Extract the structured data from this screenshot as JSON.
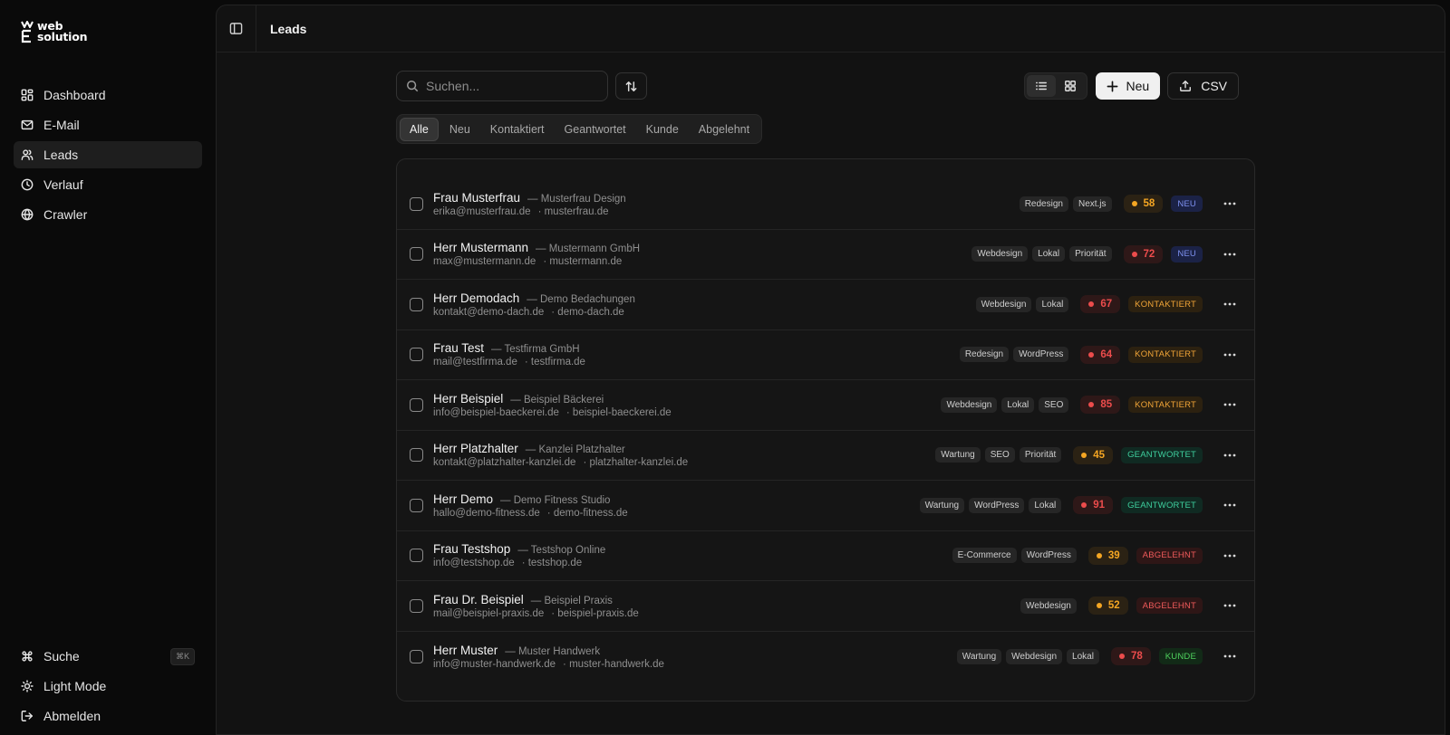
{
  "brand": {
    "line1": "web",
    "line2": "solution"
  },
  "sidebar": {
    "items": [
      {
        "label": "Dashboard",
        "icon": "dashboard-icon"
      },
      {
        "label": "E-Mail",
        "icon": "mail-icon"
      },
      {
        "label": "Leads",
        "icon": "users-icon",
        "active": true
      },
      {
        "label": "Verlauf",
        "icon": "clock-icon"
      },
      {
        "label": "Crawler",
        "icon": "globe-icon"
      }
    ],
    "bottom": [
      {
        "label": "Suche",
        "icon": "command-icon",
        "shortcut": "⌘K"
      },
      {
        "label": "Light Mode",
        "icon": "sun-icon"
      },
      {
        "label": "Abmelden",
        "icon": "logout-icon"
      }
    ]
  },
  "header": {
    "title": "Leads"
  },
  "toolbar": {
    "search_placeholder": "Suchen...",
    "new_label": "Neu",
    "csv_label": "CSV"
  },
  "tabs": [
    "Alle",
    "Neu",
    "Kontaktiert",
    "Geantwortet",
    "Kunde",
    "Abgelehnt"
  ],
  "leads": [
    {
      "name": "Frau Musterfrau",
      "company": "— Musterfrau Design",
      "email": "erika@musterfrau.de",
      "website": "· musterfrau.de",
      "tags": [
        "Redesign",
        "Next.js"
      ],
      "score": "58",
      "score_level": "amber",
      "status": "NEU",
      "status_class": "neu"
    },
    {
      "name": "Herr Mustermann",
      "company": "— Mustermann GmbH",
      "email": "max@mustermann.de",
      "website": "· mustermann.de",
      "tags": [
        "Webdesign",
        "Lokal",
        "Priorität"
      ],
      "score": "72",
      "score_level": "red",
      "status": "NEU",
      "status_class": "neu"
    },
    {
      "name": "Herr Demodach",
      "company": "— Demo Bedachungen",
      "email": "kontakt@demo-dach.de",
      "website": "· demo-dach.de",
      "tags": [
        "Webdesign",
        "Lokal"
      ],
      "score": "67",
      "score_level": "red",
      "status": "KONTAKTIERT",
      "status_class": "kontaktiert"
    },
    {
      "name": "Frau Test",
      "company": "— Testfirma GmbH",
      "email": "mail@testfirma.de",
      "website": "· testfirma.de",
      "tags": [
        "Redesign",
        "WordPress"
      ],
      "score": "64",
      "score_level": "red",
      "status": "KONTAKTIERT",
      "status_class": "kontaktiert"
    },
    {
      "name": "Herr Beispiel",
      "company": "— Beispiel Bäckerei",
      "email": "info@beispiel-baeckerei.de",
      "website": "· beispiel-baeckerei.de",
      "tags": [
        "Webdesign",
        "Lokal",
        "SEO"
      ],
      "score": "85",
      "score_level": "red",
      "status": "KONTAKTIERT",
      "status_class": "kontaktiert"
    },
    {
      "name": "Herr Platzhalter",
      "company": "— Kanzlei Platzhalter",
      "email": "kontakt@platzhalter-kanzlei.de",
      "website": "· platzhalter-kanzlei.de",
      "tags": [
        "Wartung",
        "SEO",
        "Priorität"
      ],
      "score": "45",
      "score_level": "amber",
      "status": "GEANTWORTET",
      "status_class": "geantwortet"
    },
    {
      "name": "Herr Demo",
      "company": "— Demo Fitness Studio",
      "email": "hallo@demo-fitness.de",
      "website": "· demo-fitness.de",
      "tags": [
        "Wartung",
        "WordPress",
        "Lokal"
      ],
      "score": "91",
      "score_level": "red",
      "status": "GEANTWORTET",
      "status_class": "geantwortet"
    },
    {
      "name": "Frau Testshop",
      "company": "— Testshop Online",
      "email": "info@testshop.de",
      "website": "· testshop.de",
      "tags": [
        "E-Commerce",
        "WordPress"
      ],
      "score": "39",
      "score_level": "amber",
      "status": "ABGELEHNT",
      "status_class": "abgelehnt"
    },
    {
      "name": "Frau Dr. Beispiel",
      "company": "— Beispiel Praxis",
      "email": "mail@beispiel-praxis.de",
      "website": "· beispiel-praxis.de",
      "tags": [
        "Webdesign"
      ],
      "score": "52",
      "score_level": "amber",
      "status": "ABGELEHNT",
      "status_class": "abgelehnt"
    },
    {
      "name": "Herr Muster",
      "company": "— Muster Handwerk",
      "email": "info@muster-handwerk.de",
      "website": "· muster-handwerk.de",
      "tags": [
        "Wartung",
        "Webdesign",
        "Lokal"
      ],
      "score": "78",
      "score_level": "red",
      "status": "KUNDE",
      "status_class": "kunde"
    }
  ]
}
